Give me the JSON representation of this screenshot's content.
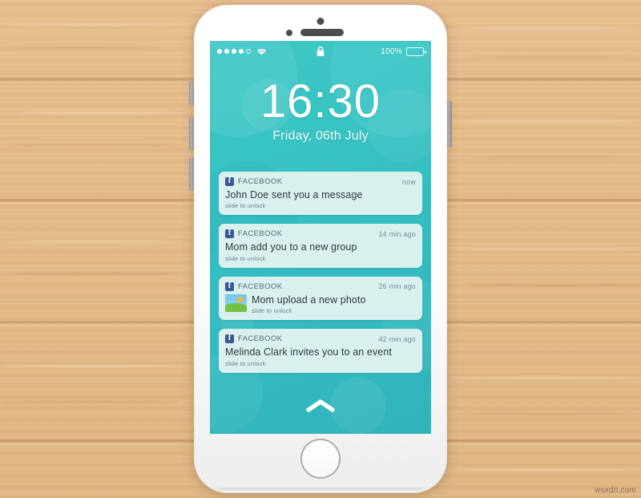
{
  "watermark": "wsxdn.com",
  "device": {
    "hardware": {
      "camera": "camera-dot",
      "sensor": "proximity-sensor-dot",
      "speaker": "earpiece-speaker",
      "home_button": "home-button",
      "silent_switch": "silent-switch",
      "volume_up": "volume-up-button",
      "volume_down": "volume-down-button",
      "power": "power-button"
    }
  },
  "status_bar": {
    "signal_dots_total": 5,
    "signal_dots_filled": 4,
    "wifi_icon": "wifi-icon",
    "lock_icon": "lock-closed-icon",
    "battery_percent": "100%",
    "battery_icon": "battery-full-icon"
  },
  "lockscreen": {
    "time": "16:30",
    "date": "Friday, 06th July",
    "unlock_chevron": "chevron-up-icon"
  },
  "colors": {
    "wallpaper_teal": "#35bfc2",
    "notification_card": "#d9f0ef",
    "facebook_blue": "#3b5998",
    "wood": "#e2b885"
  },
  "notifications": [
    {
      "app": "FACEBOOK",
      "time": "now",
      "message": "John Doe sent you a message",
      "hint": "slide to unlock",
      "has_thumbnail": false
    },
    {
      "app": "FACEBOOK",
      "time": "14 min ago",
      "message": "Mom add you to a new group",
      "hint": "slide to unlock",
      "has_thumbnail": false
    },
    {
      "app": "FACEBOOK",
      "time": "26 min ago",
      "message": "Mom upload a new photo",
      "hint": "slide to unlock",
      "has_thumbnail": true,
      "thumbnail": "photo-thumbnail"
    },
    {
      "app": "FACEBOOK",
      "time": "42 min ago",
      "message": "Melinda Clark invites you to an event",
      "hint": "slide to unlock",
      "has_thumbnail": false
    }
  ]
}
